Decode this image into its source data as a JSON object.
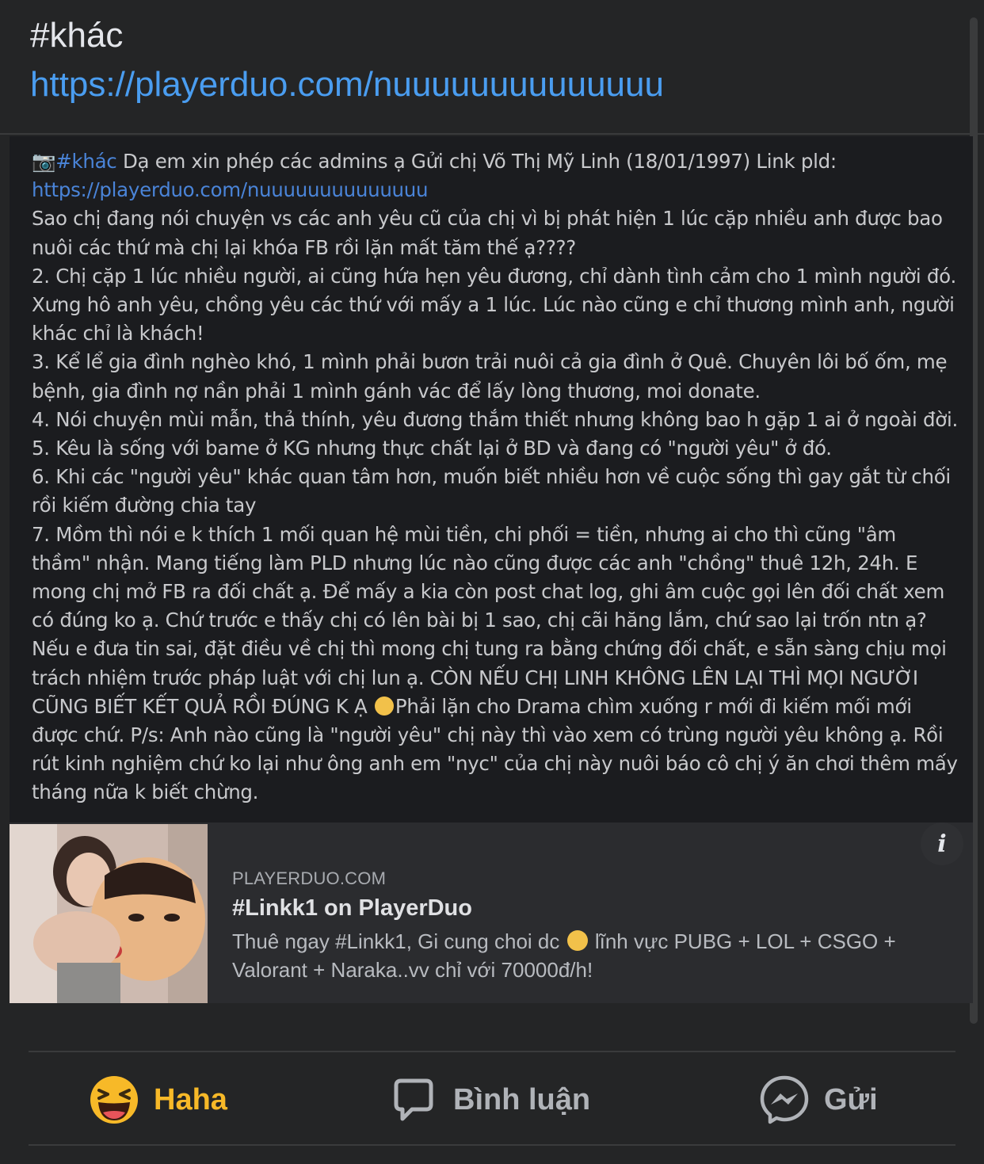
{
  "post": {
    "hashtag": "#khác",
    "link": "https://playerduo.com/nuuuuuuuuuuuuuu"
  },
  "shared": {
    "cam_icon": "camera-emoji",
    "tag": "#khác",
    "intro": " Dạ em xin phép các admins ạ Gửi chị Võ Thị Mỹ Linh (18/01/1997) Link pld:",
    "link": "https://playerduo.com/nuuuuuuuuuuuuuu",
    "lines": [
      "Sao chị đang nói chuyện vs các anh yêu cũ của chị vì bị phát hiện 1 lúc cặp nhiều anh được bao",
      "nuôi các thứ mà chị lại khóa FB rồi lặn mất tăm thế ạ????",
      "2. Chị cặp 1 lúc nhiều người, ai cũng hứa hẹn yêu đương, chỉ dành tình cảm cho 1 mình người đó.",
      "Xưng hô anh yêu, chồng yêu các thứ với mấy a 1 lúc. Lúc nào cũng e chỉ thương mình anh, người",
      "khác chỉ là khách!",
      "3. Kể lể gia đình nghèo khó, 1 mình phải bươn trải nuôi cả gia đình ở Quê. Chuyên lôi bố ốm, mẹ",
      "bệnh, gia đình nợ nần phải 1 mình gánh vác để lấy lòng thương, moi donate.",
      "4. Nói chuyện mùi mẫn, thả thính, yêu đương thắm thiết nhưng không bao h gặp 1 ai ở ngoài đời.",
      "5. Kêu là sống với bame ở KG nhưng thực chất lại ở BD và đang có \"người yêu\" ở đó.",
      "6. Khi các \"người yêu\" khác quan tâm hơn, muốn biết nhiều hơn về cuộc sống thì gay gắt từ chối",
      "rồi kiếm đường chia tay",
      "7. Mồm thì nói e k thích 1 mối quan hệ mùi tiền, chi phối = tiền, nhưng ai cho thì cũng \"âm",
      "thầm\" nhận. Mang tiếng làm PLD nhưng lúc nào cũng được các anh \"chồng\" thuê 12h, 24h. E",
      "mong chị mở FB ra đối chất ạ. Để mấy a kia còn post chat log, ghi âm cuộc gọi lên đối chất xem",
      "có đúng ko ạ. Chứ trước e thấy chị có lên bài bị 1 sao, chị cãi hăng lắm, chứ sao lại trốn ntn ạ?",
      "Nếu e đưa tin sai, đặt điều về chị thì mong chị tung ra bằng chứng đối chất, e sẵn sàng chịu mọi",
      "trách nhiệm trước pháp luật với chị lun ạ. CÒN NẾU CHỊ LINH KHÔNG LÊN LẠI THÌ MỌI NGƯỜI"
    ],
    "line_emoji_before": "CŨNG BIẾT KẾT QUẢ RỒI ĐÚNG K Ạ ",
    "line_emoji_after": "Phải lặn cho Drama chìm xuống r mới đi kiếm mối mới",
    "tail_lines": [
      "được chứ. P/s: Anh nào cũng là \"người yêu\" chị này thì vào xem có trùng người yêu không ạ. Rồi",
      "rút kinh nghiệm chứ ko lại như ông anh em \"nyc\" của chị này nuôi báo cô chị ý ăn chơi thêm mấy",
      "tháng nữa k biết chừng."
    ],
    "preview": {
      "domain": "PLAYERDUO.COM",
      "title": "#Linkk1 on PlayerDuo",
      "desc_before": "Thuê ngay #Linkk1, Gi cung choi dc ",
      "desc_after": " lĩnh vực PUBG + LOL + CSGO +",
      "desc_line2": "Valorant + Naraka..vv chỉ với 70000đ/h!",
      "info_label": "i"
    }
  },
  "actions": {
    "haha": "Haha",
    "comment": "Bình luận",
    "send": "Gửi"
  },
  "colors": {
    "background": "#242526",
    "link": "#4a9df0",
    "haha": "#f7b928",
    "muted": "#b0b3b8"
  }
}
